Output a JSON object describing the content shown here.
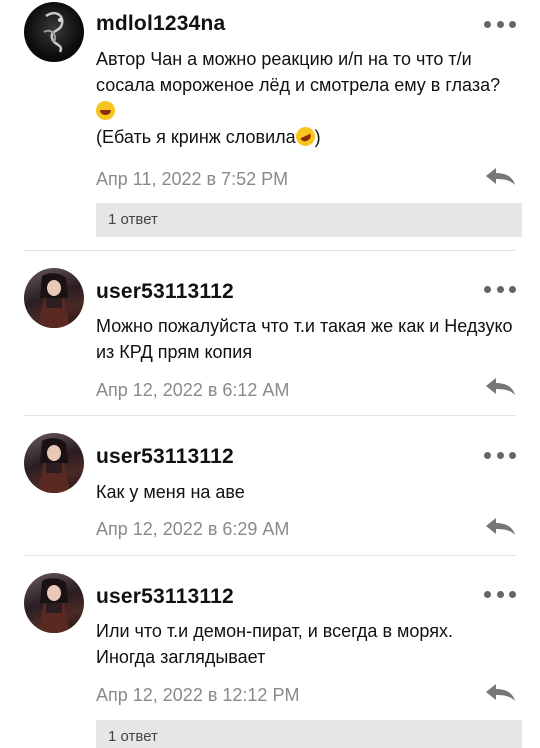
{
  "comments": [
    {
      "username": "mdlol1234na",
      "text_part1": "Автор Чан а можно реакцию и/п на то что т/и сосала мороженое лёд и смотрела ему в глаза? ",
      "text_part2": "(Ебать я кринж словила",
      "text_part3": ")",
      "timestamp": "Апр 11, 2022 в 7:52 PM",
      "replies_label": "1 ответ"
    },
    {
      "username": "user53113112",
      "text": "Можно пожалуйста что т.и такая же как и Недзуко из КРД прям копия",
      "timestamp": "Апр 12, 2022 в 6:12 AM"
    },
    {
      "username": "user53113112",
      "text": "Как у меня на аве",
      "timestamp": "Апр 12, 2022 в 6:29 AM"
    },
    {
      "username": "user53113112",
      "text": "Или что т.и демон-пират, и всегда в морях. Иногда заглядывает",
      "timestamp": "Апр 12, 2022 в 12:12 PM",
      "replies_label": "1 ответ"
    }
  ],
  "icons": {
    "menu": "more-dots-icon",
    "reply": "reply-arrow-icon",
    "emoji_laugh": "grinning-sweat-emoji",
    "emoji_rofl": "rolling-laughing-emoji"
  },
  "colors": {
    "meta_text": "#8a8a8a",
    "reply_bar_bg": "#e6e6e6",
    "icon_gray": "#666666"
  }
}
